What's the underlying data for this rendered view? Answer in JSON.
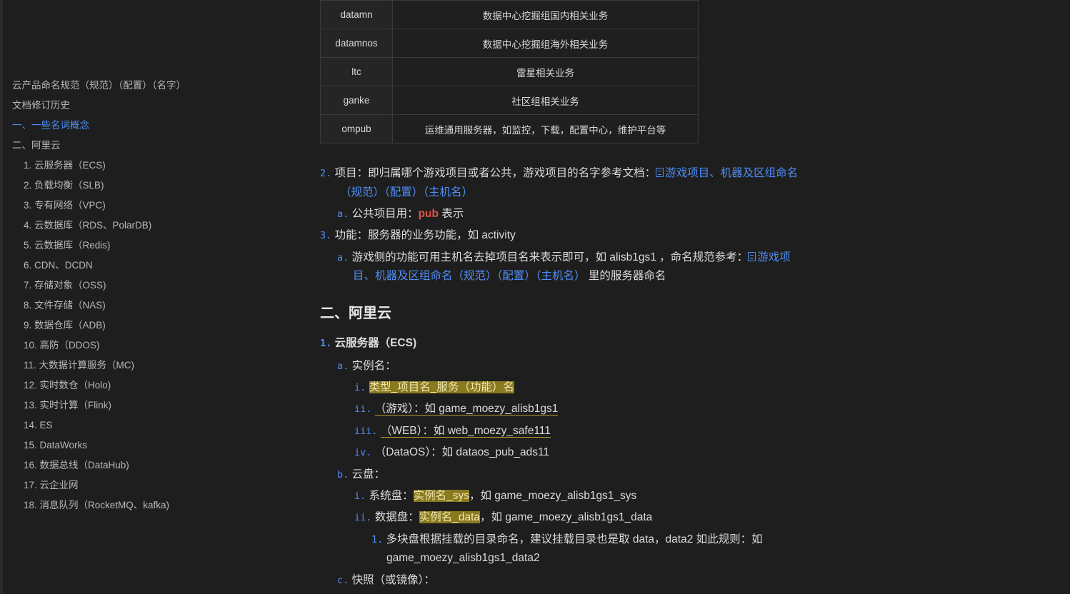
{
  "toc": [
    {
      "label": "云产品命名规范（规范）（配置）（名字）",
      "level": 1,
      "active": false
    },
    {
      "label": "文档修订历史",
      "level": 1,
      "active": false
    },
    {
      "label": "一、一些名词概念",
      "level": 1,
      "active": true
    },
    {
      "label": "二、阿里云",
      "level": 1,
      "active": false
    },
    {
      "label": "1. 云服务器（ECS)",
      "level": 2,
      "active": false
    },
    {
      "label": "2. 负载均衡（SLB)",
      "level": 2,
      "active": false
    },
    {
      "label": "3. 专有网络（VPC)",
      "level": 2,
      "active": false
    },
    {
      "label": "4. 云数据库（RDS、PolarDB)",
      "level": 2,
      "active": false
    },
    {
      "label": "5. 云数据库（Redis)",
      "level": 2,
      "active": false
    },
    {
      "label": "6. CDN、DCDN",
      "level": 2,
      "active": false
    },
    {
      "label": "7. 存储对象（OSS)",
      "level": 2,
      "active": false
    },
    {
      "label": "8. 文件存储（NAS)",
      "level": 2,
      "active": false
    },
    {
      "label": "9. 数据仓库（ADB)",
      "level": 2,
      "active": false
    },
    {
      "label": "10. 高防（DDOS)",
      "level": 2,
      "active": false
    },
    {
      "label": "11. 大数据计算服务（MC)",
      "level": 2,
      "active": false
    },
    {
      "label": "12. 实时数仓（Holo)",
      "level": 2,
      "active": false
    },
    {
      "label": "13. 实时计算（Flink)",
      "level": 2,
      "active": false
    },
    {
      "label": "14. ES",
      "level": 2,
      "active": false
    },
    {
      "label": "15. DataWorks",
      "level": 2,
      "active": false
    },
    {
      "label": "16. 数据总线（DataHub)",
      "level": 2,
      "active": false
    },
    {
      "label": "17. 云企业网",
      "level": 2,
      "active": false
    },
    {
      "label": "18. 消息队列（RocketMQ、kafka)",
      "level": 2,
      "active": false
    }
  ],
  "table": [
    {
      "key": "datamn",
      "value": "数据中心挖掘组国内相关业务"
    },
    {
      "key": "datamnos",
      "value": "数据中心挖掘组海外相关业务"
    },
    {
      "key": "ltc",
      "value": "雷星相关业务"
    },
    {
      "key": "ganke",
      "value": "社区组相关业务"
    },
    {
      "key": "ompub",
      "value": "运维通用服务器，如监控，下载，配置中心，维护平台等"
    }
  ],
  "content": {
    "item2": {
      "num": "2.",
      "text": "项目：即归属哪个游戏项目或者公共，游戏项目的名字参考文档：",
      "link1": "游戏项目、机器及区组命名",
      "link2": "（规范）（配置）（主机名）",
      "sub_a_num": "a.",
      "sub_a_text": "公共项目用：",
      "sub_a_code": "pub",
      "sub_a_tail": " 表示"
    },
    "item3": {
      "num": "3.",
      "text": "功能：服务器的业务功能，如 activity",
      "sub_a_num": "a.",
      "sub_a_text": "游戏侧的功能可用主机名去掉项目名来表示即可，如 alisb1gs1 ，命名规范参考：",
      "link1": "游戏项",
      "link2": "目、机器及区组命名（规范）（配置）（主机名）",
      "tail": " 里的服务器命名"
    },
    "section_title": "二、阿里云",
    "ecs": {
      "num": "1.",
      "title": "云服务器（ECS)",
      "a_num": "a.",
      "a_label": "实例名：",
      "i_num": "i.",
      "i_text": "类型_项目名_服务（功能）名",
      "ii_num": "ii.",
      "ii_text": "（游戏）：如 game_moezy_alisb1gs1",
      "iii_num": "iii.",
      "iii_text": "（WEB）：如 web_moezy_safe111",
      "iv_num": "iv.",
      "iv_text": "（DataOS）：如 dataos_pub_ads11",
      "b_num": "b.",
      "b_label": "云盘：",
      "bi_num": "i.",
      "bi_prefix": "系统盘：",
      "bi_hl": "实例名_sys",
      "bi_tail": "，如 game_moezy_alisb1gs1_sys",
      "bii_num": "ii.",
      "bii_prefix": "数据盘：",
      "bii_hl": "实例名_data",
      "bii_tail": "，如 game_moezy_alisb1gs1_data",
      "b1_num": "1.",
      "b1_text": "多块盘根据挂载的目录命名，建议挂载目录也是取 data，data2 如此规则：如",
      "b1_text2": "game_moezy_alisb1gs1_data2",
      "c_num": "c.",
      "c_label": "快照（或镜像）："
    }
  }
}
